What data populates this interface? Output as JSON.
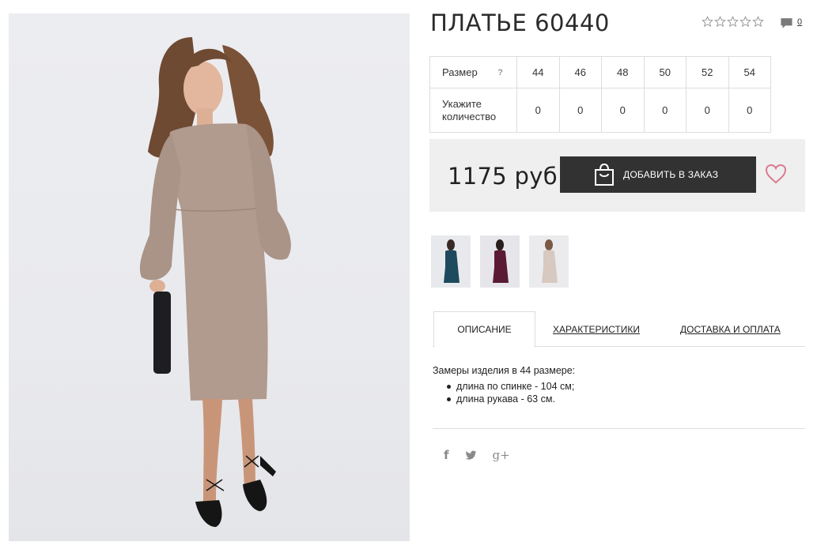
{
  "product": {
    "title": "ПЛАТЬЕ 60440",
    "rating_stars": 0,
    "rating_max": 5,
    "comments_count": "0"
  },
  "size_table": {
    "size_label": "Размер",
    "help_mark": "?",
    "qty_label_line1": "Укажите",
    "qty_label_line2": "количество",
    "sizes": [
      "44",
      "46",
      "48",
      "50",
      "52",
      "54"
    ],
    "quantities": [
      "0",
      "0",
      "0",
      "0",
      "0",
      "0"
    ]
  },
  "purchase": {
    "price": "1175 руб",
    "order_button": "ДОБАВИТЬ В ЗАКАЗ"
  },
  "thumbnails": [
    {
      "color": "#1d4a5c"
    },
    {
      "color": "#5a1a33"
    },
    {
      "color": "#d7c9c0"
    }
  ],
  "tabs": {
    "description": "ОПИСАНИЕ",
    "characteristics": "ХАРАКТЕРИСТИКИ",
    "delivery": "ДОСТАВКА И ОПЛАТА"
  },
  "description": {
    "intro": "Замеры изделия в 44 размере:",
    "items": [
      "длина по спинке - 104 см;",
      "длина рукава - 63 см."
    ]
  },
  "social": {
    "facebook": "f",
    "google": "g+"
  },
  "colors": {
    "button_bg": "#323232",
    "price_block_bg": "#efefef",
    "heart": "#d97a8f",
    "dress": "#b19a8e"
  }
}
